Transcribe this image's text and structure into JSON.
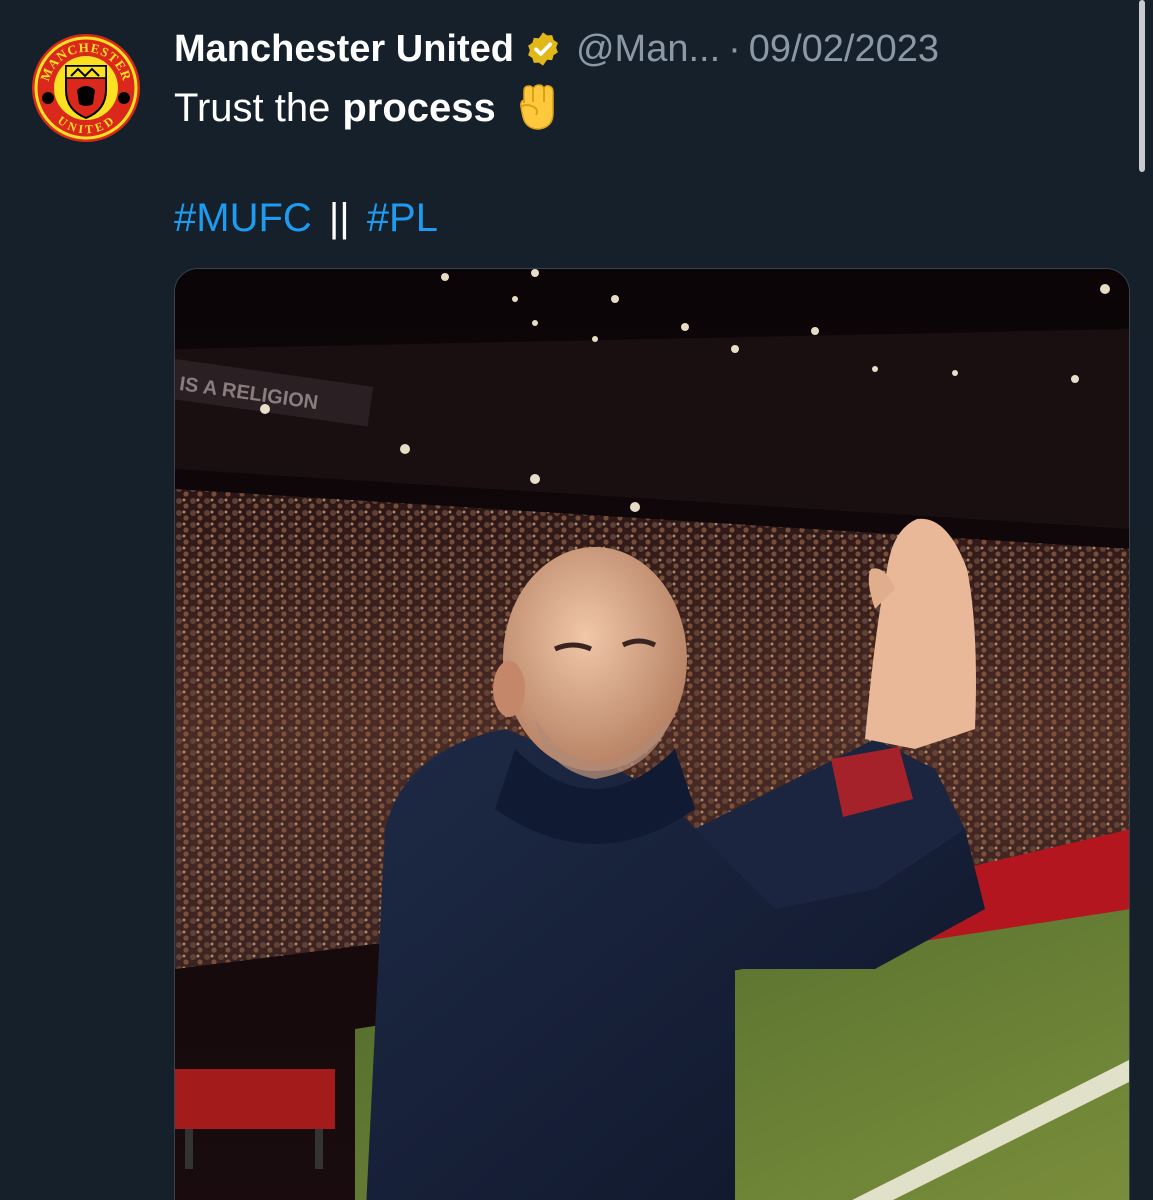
{
  "tweet": {
    "display_name": "Manchester United",
    "handle": "@Man...",
    "separator": "·",
    "date": "09/02/2023",
    "text_plain": "Trust the",
    "text_bold": "process",
    "hashtag_1": "#MUFC",
    "hashtag_separator": "||",
    "hashtag_2": "#PL",
    "verified_badge_color": "#e2b719",
    "link_color": "#1d9bf0"
  },
  "avatar": {
    "crest_text_top": "MANCHESTER",
    "crest_text_bottom": "UNITED",
    "crest_colors": [
      "#da291c",
      "#fbe122",
      "#000000"
    ]
  },
  "media": {
    "banner_text": "IS A RELIGION"
  },
  "colors": {
    "background": "#15202b",
    "muted_text": "#8b98a5"
  }
}
